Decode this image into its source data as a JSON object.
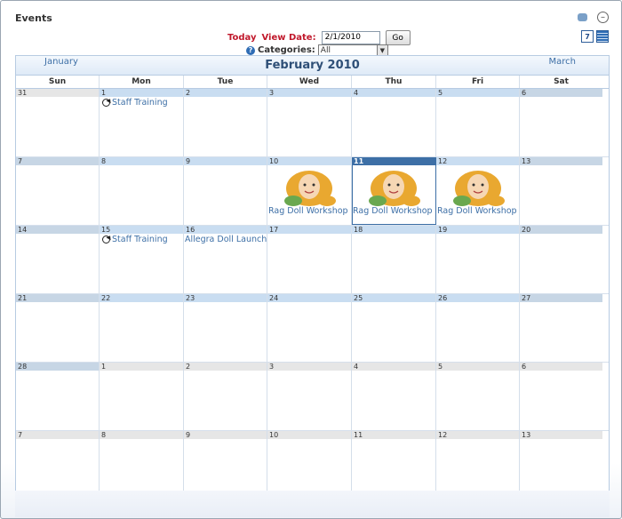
{
  "window": {
    "title": "Events"
  },
  "controls": {
    "today_label": "Today",
    "view_date_label": "View Date:",
    "view_date_value": "2/1/2010",
    "go_label": "Go",
    "categories_label": "Categories:",
    "categories_selected": "All"
  },
  "calendar": {
    "prev_month": "January",
    "next_month": "March",
    "month_title": "February 2010",
    "days_of_week": [
      "Sun",
      "Mon",
      "Tue",
      "Wed",
      "Thu",
      "Fri",
      "Sat"
    ],
    "weeks": [
      [
        "31",
        "1",
        "2",
        "3",
        "4",
        "5",
        "6"
      ],
      [
        "7",
        "8",
        "9",
        "10",
        "11",
        "12",
        "13"
      ],
      [
        "14",
        "15",
        "16",
        "17",
        "18",
        "19",
        "20"
      ],
      [
        "21",
        "22",
        "23",
        "24",
        "25",
        "26",
        "27"
      ],
      [
        "28",
        "1",
        "2",
        "3",
        "4",
        "5",
        "6"
      ],
      [
        "7",
        "8",
        "9",
        "10",
        "11",
        "12",
        "13"
      ]
    ],
    "events": {
      "staff_training_1": "Staff Training",
      "rag_doll_wed": "Rag Doll Workshop",
      "rag_doll_thu": "Rag Doll Workshop",
      "rag_doll_fri": "Rag Doll Workshop",
      "staff_training_2": "Staff Training",
      "allegra": "Allegra Doll Launch"
    }
  },
  "colors": {
    "accent": "#3d6fa6",
    "today_red": "#c0182b",
    "day_header": "#c9ddf1"
  },
  "icons": [
    "users-icon",
    "collapse-icon",
    "week-view-icon",
    "list-view-icon",
    "help-icon",
    "recurring-icon",
    "dropdown-caret-icon"
  ]
}
